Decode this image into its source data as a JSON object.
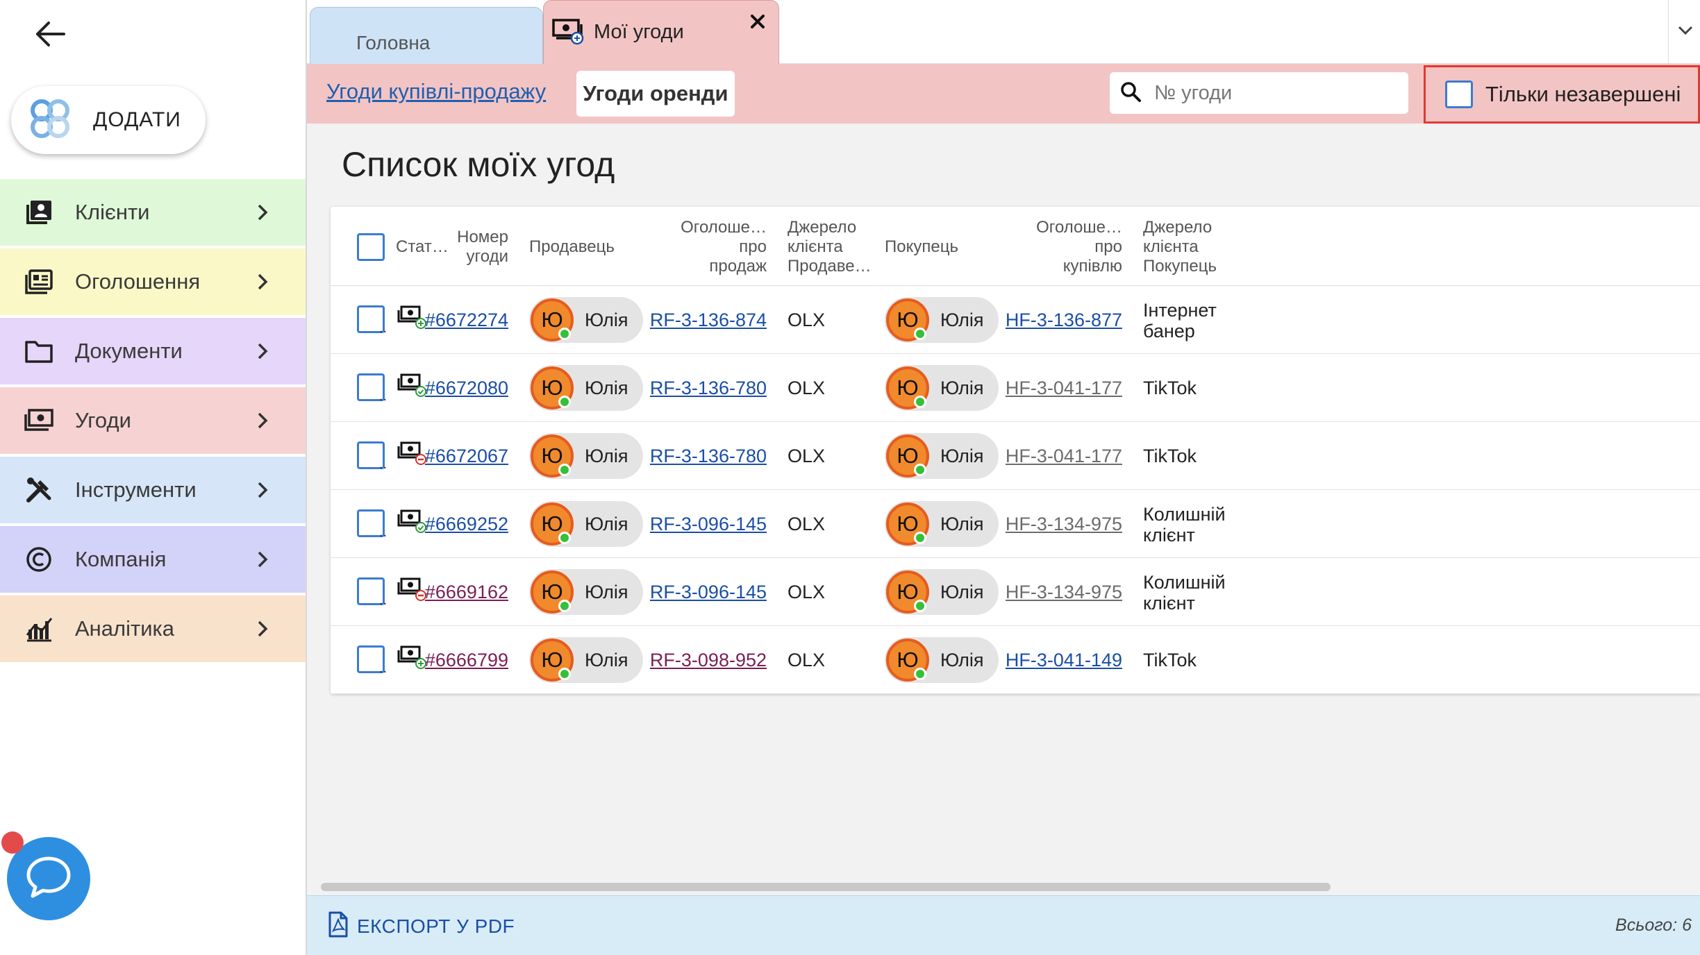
{
  "sidebar": {
    "add_label": "ДОДАТИ",
    "items": [
      {
        "label": "Клієнти",
        "icon": "contacts-icon",
        "color": "#dff8d8"
      },
      {
        "label": "Оголошення",
        "icon": "listing-icon",
        "color": "#fbf8c8"
      },
      {
        "label": "Документи",
        "icon": "folder-icon",
        "color": "#e6d6fa"
      },
      {
        "label": "Угоди",
        "icon": "money-icon",
        "color": "#f6d2d2"
      },
      {
        "label": "Інструменти",
        "icon": "tools-icon",
        "color": "#d6e6f8"
      },
      {
        "label": "Компанія",
        "icon": "copyright-icon",
        "color": "#d3d2f8"
      },
      {
        "label": "Аналітика",
        "icon": "analytics-icon",
        "color": "#f9e2cc"
      }
    ]
  },
  "tabs": {
    "home": "Головна",
    "active": "Мої угоди"
  },
  "subbar": {
    "link_sales": "Угоди купівлі-продажу",
    "active_rent": "Угоди оренди",
    "search_placeholder": "№ угоди",
    "filter_label": "Тільки незавершені"
  },
  "page_title": "Список моїх угод",
  "table": {
    "headers": {
      "status": "Стат…",
      "number": [
        "Номер",
        "угоди"
      ],
      "seller": "Продавець",
      "sale_ad": [
        "Оголоше…",
        "про",
        "продаж"
      ],
      "seller_source": [
        "Джерело",
        "клієнта",
        "Продаве…"
      ],
      "buyer": "Покупець",
      "buy_ad": [
        "Оголоше…",
        "про",
        "купівлю"
      ],
      "buyer_source": [
        "Джерело",
        "клієнта",
        "Покупець"
      ]
    },
    "rows": [
      {
        "dots": "..",
        "status": "new",
        "number": "#6672274",
        "number_style": "blue",
        "seller_initial": "Ю",
        "seller": "Юлія",
        "sale_ad": "RF-3-136-874",
        "sale_ad_style": "blue",
        "seller_source": "OLX",
        "buyer_initial": "Ю",
        "buyer": "Юлія",
        "buy_ad": "HF-3-136-877",
        "buy_ad_style": "blue",
        "buyer_source": [
          "Інтернет",
          "банер"
        ]
      },
      {
        "dots": "..",
        "status": "done",
        "number": "#6672080",
        "number_style": "blue",
        "seller_initial": "Ю",
        "seller": "Юлія",
        "sale_ad": "RF-3-136-780",
        "sale_ad_style": "blue",
        "seller_source": "OLX",
        "buyer_initial": "Ю",
        "buyer": "Юлія",
        "buy_ad": "HF-3-041-177",
        "buy_ad_style": "grey",
        "buyer_source": [
          "TikTok"
        ]
      },
      {
        "dots": "..",
        "status": "cancelled",
        "number": "#6672067",
        "number_style": "blue",
        "seller_initial": "Ю",
        "seller": "Юлія",
        "sale_ad": "RF-3-136-780",
        "sale_ad_style": "blue",
        "seller_source": "OLX",
        "buyer_initial": "Ю",
        "buyer": "Юлія",
        "buy_ad": "HF-3-041-177",
        "buy_ad_style": "grey",
        "buyer_source": [
          "TikTok"
        ]
      },
      {
        "dots": "..",
        "status": "done",
        "number": "#6669252",
        "number_style": "blue",
        "seller_initial": "Ю",
        "seller": "Юлія",
        "sale_ad": "RF-3-096-145",
        "sale_ad_style": "blue",
        "seller_source": "OLX",
        "buyer_initial": "Ю",
        "buyer": "Юлія",
        "buy_ad": "HF-3-134-975",
        "buy_ad_style": "grey",
        "buyer_source": [
          "Колишній",
          "клієнт"
        ]
      },
      {
        "dots": "..",
        "status": "cancelled",
        "number": "#6669162",
        "number_style": "visited",
        "seller_initial": "Ю",
        "seller": "Юлія",
        "sale_ad": "RF-3-096-145",
        "sale_ad_style": "blue",
        "seller_source": "OLX",
        "buyer_initial": "Ю",
        "buyer": "Юлія",
        "buy_ad": "HF-3-134-975",
        "buy_ad_style": "grey",
        "buyer_source": [
          "Колишній",
          "клієнт"
        ]
      },
      {
        "dots": "..",
        "status": "new",
        "number": "#6666799",
        "number_style": "visited",
        "seller_initial": "Ю",
        "seller": "Юлія",
        "sale_ad": "RF-3-098-952",
        "sale_ad_style": "visited",
        "seller_source": "OLX",
        "buyer_initial": "Ю",
        "buyer": "Юлія",
        "buy_ad": "HF-3-041-149",
        "buy_ad_style": "blue",
        "buyer_source": [
          "TikTok"
        ]
      }
    ]
  },
  "footer": {
    "export_label": "ЕКСПОРТ У PDF",
    "total": "Всього: 6"
  },
  "colors": {
    "accent_tab": "#f3c4c4",
    "home_tab": "#cfe3f7",
    "link": "#1a4ea6",
    "visited_link": "#7a1f55",
    "filter_highlight": "#e03a2f",
    "avatar": "#f08a2c",
    "online": "#35c03b",
    "chat_fab": "#2e8fe0"
  }
}
